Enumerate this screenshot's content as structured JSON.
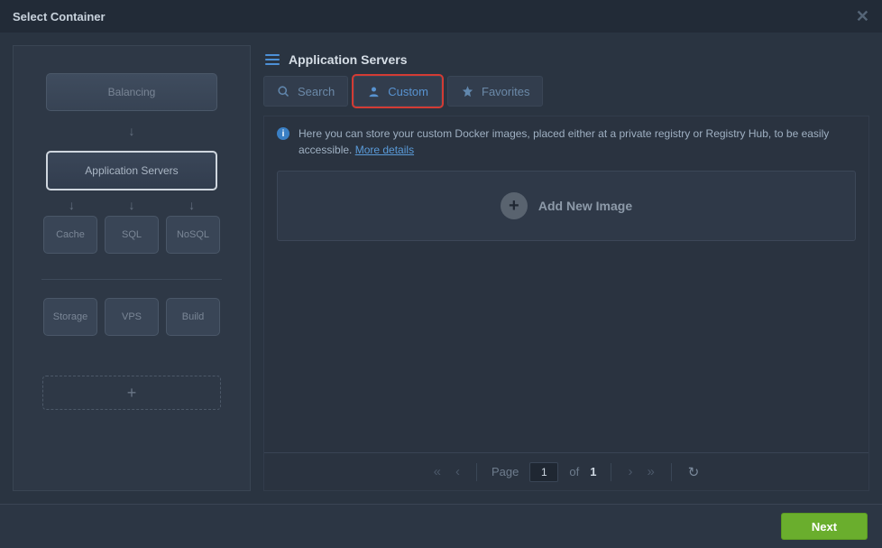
{
  "window": {
    "title": "Select Container"
  },
  "sidebar": {
    "balancing": "Balancing",
    "app_servers": "Application Servers",
    "row1": {
      "cache": "Cache",
      "sql": "SQL",
      "nosql": "NoSQL"
    },
    "row2": {
      "storage": "Storage",
      "vps": "VPS",
      "build": "Build"
    },
    "add": "+"
  },
  "main": {
    "title": "Application Servers",
    "tabs": {
      "search": "Search",
      "custom": "Custom",
      "favorites": "Favorites"
    },
    "info_text": "Here you can store your custom Docker images, placed either at a private registry or Registry Hub, to be easily accessible. ",
    "info_link": "More details",
    "add_image": "Add New Image",
    "pager": {
      "page_label": "Page",
      "page_current": "1",
      "of_label": "of",
      "page_total": "1"
    }
  },
  "footer": {
    "next": "Next"
  }
}
